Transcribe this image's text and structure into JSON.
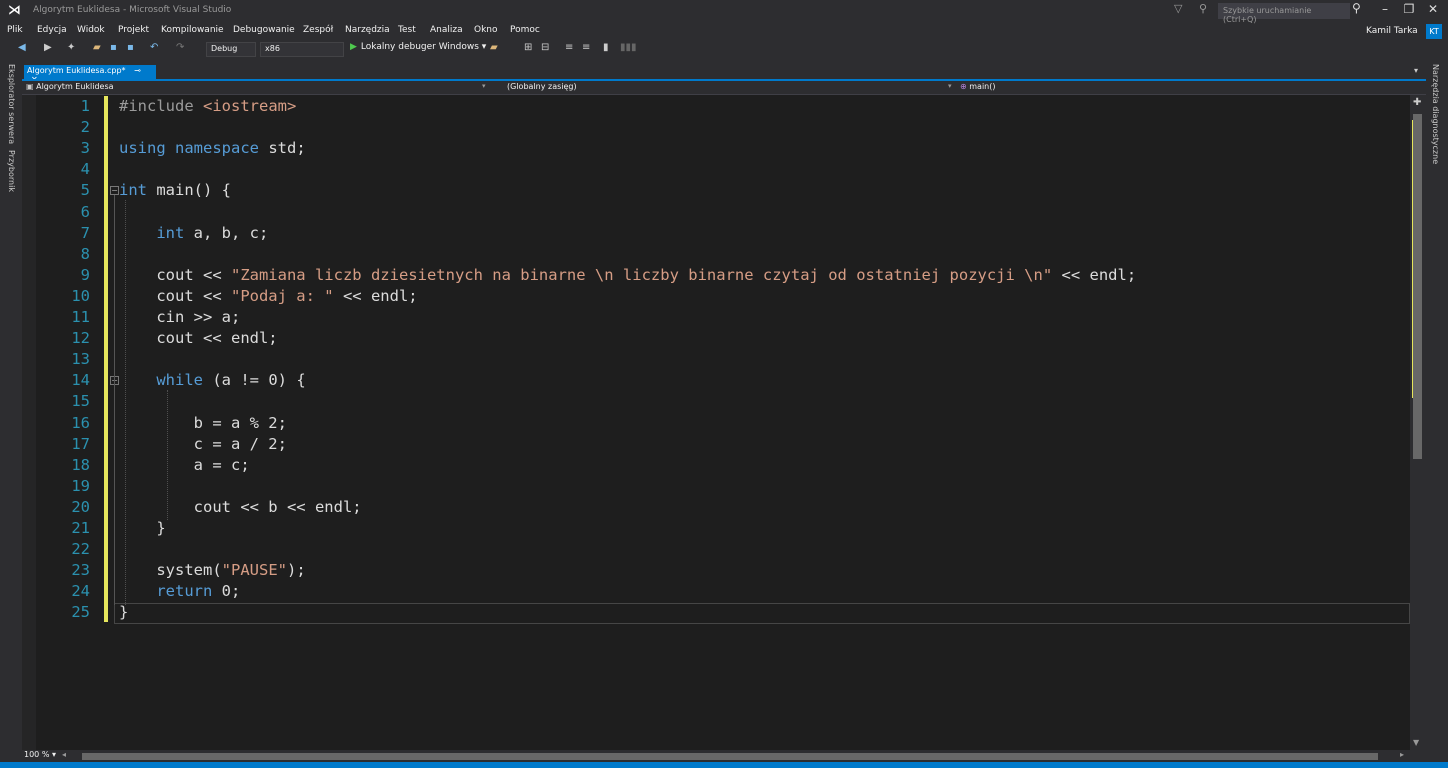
{
  "window": {
    "title": "Algorytm Euklidesa - Microsoft Visual Studio",
    "quick_launch_placeholder": "Szybkie uruchamianie (Ctrl+Q)",
    "user": "Kamil Tarka",
    "user_initials": "KT"
  },
  "menu": [
    "Plik",
    "Edycja",
    "Widok",
    "Projekt",
    "Kompilowanie",
    "Debugowanie",
    "Zespół",
    "Narzędzia",
    "Test",
    "Analiza",
    "Okno",
    "Pomoc"
  ],
  "toolbar": {
    "config": "Debug",
    "platform": "x86",
    "run_label": "Lokalny debuger Windows"
  },
  "side_panels": {
    "left": [
      "Eksplorator serwera",
      "Przybornik"
    ],
    "right": [
      "Narzędzia diagnostyczne"
    ]
  },
  "tab": {
    "label": "Algorytm Euklidesa.cpp*"
  },
  "navbar": {
    "project": "Algorytm Euklidesa",
    "scope": "(Globalny zasięg)",
    "member": "main()"
  },
  "editor": {
    "zoom": "100 %",
    "lines": [
      "#include <iostream>",
      "",
      "using namespace std;",
      "",
      "int main() {",
      "",
      "    int a, b, c;",
      "",
      "    cout << \"Zamiana liczb dziesietnych na binarne \\n liczby binarne czytaj od ostatniej pozycji \\n\" << endl;",
      "    cout << \"Podaj a: \" << endl;",
      "    cin >> a;",
      "    cout << endl;",
      "",
      "    while (a != 0) {",
      "",
      "        b = a % 2;",
      "        c = a / 2;",
      "        a = c;",
      "",
      "        cout << b << endl;",
      "    }",
      "",
      "    system(\"PAUSE\");",
      "    return 0;",
      "}"
    ]
  },
  "syntax_colors": {
    "keyword": "#569cd6",
    "string": "#d69d85",
    "preprocessor": "#9b9b9b",
    "line_number": "#2b91af",
    "change_bar": "#e6e65c",
    "accent": "#007acc"
  }
}
